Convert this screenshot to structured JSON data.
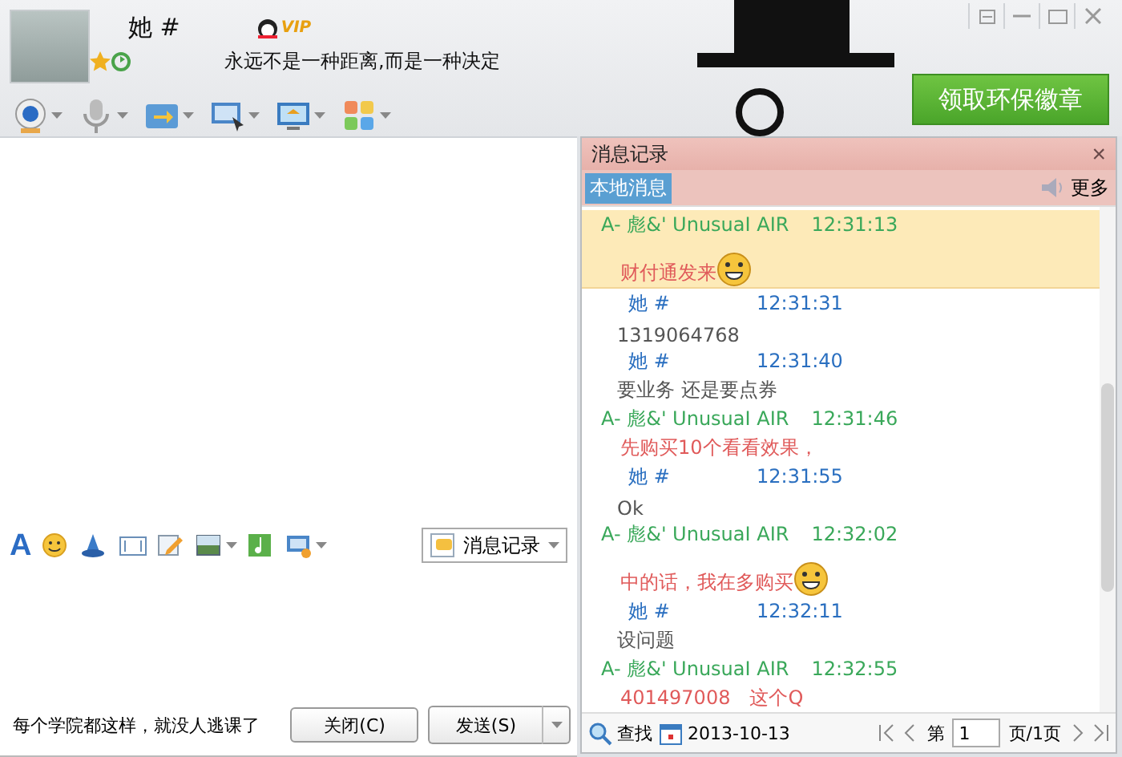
{
  "contact": {
    "name": "她 #",
    "vip_badge": "VIP",
    "signature": "永远不是一种距离,而是一种决定"
  },
  "promo_banner": "领取环保徽章",
  "chat": {
    "font_button": "A",
    "history_button": "消息记录",
    "status_text": "每个学院都这样，就没人逃课了",
    "close_button": "关闭(C)",
    "send_button": "发送(S)"
  },
  "history": {
    "title": "消息记录",
    "close": "×",
    "tab": "本地消息",
    "more": "更多",
    "messages": [
      {
        "kind": "friend",
        "sender": "A- 彪&' UnusuaI AIR",
        "time": "12:31:13",
        "text": "财付通发来",
        "emoji": true,
        "highlighted": true
      },
      {
        "kind": "me",
        "sender": "她 #",
        "time": "12:31:31",
        "text": "1319064768",
        "emoji": false,
        "highlighted": false
      },
      {
        "kind": "me",
        "sender": "她 #",
        "time": "12:31:40",
        "text": "要业务 还是要点券",
        "emoji": false,
        "highlighted": false
      },
      {
        "kind": "friend",
        "sender": "A- 彪&' UnusuaI AIR",
        "time": "12:31:46",
        "text": "先购买10个看看效果，",
        "emoji": false,
        "highlighted": false
      },
      {
        "kind": "me",
        "sender": "她 #",
        "time": "12:31:55",
        "text": "Ok",
        "emoji": false,
        "highlighted": false
      },
      {
        "kind": "friend",
        "sender": "A- 彪&' UnusuaI AIR",
        "time": "12:32:02",
        "text": "中的话，我在多购买",
        "emoji": true,
        "highlighted": false
      },
      {
        "kind": "me",
        "sender": "她 #",
        "time": "12:32:11",
        "text": "设问题",
        "emoji": false,
        "highlighted": false
      },
      {
        "kind": "friend",
        "sender": "A- 彪&' UnusuaI AIR",
        "time": "12:32:55",
        "text": "401497008　这个Q",
        "emoji": false,
        "highlighted": false
      }
    ],
    "search": "查找",
    "date": "2013-10-13",
    "page_prefix": "第",
    "page_value": "1",
    "page_suffix": "页/1页"
  }
}
